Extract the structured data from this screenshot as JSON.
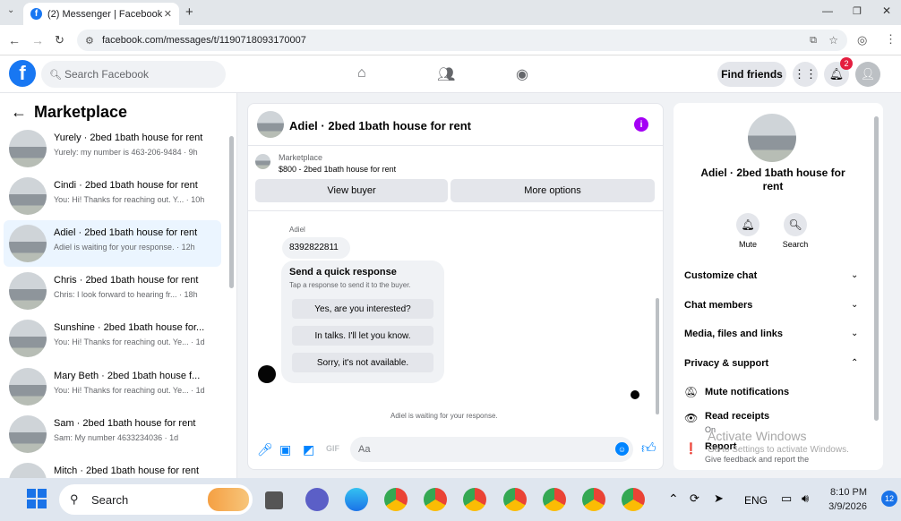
{
  "browser": {
    "tab_title": "(2) Messenger | Facebook",
    "url": "facebook.com/messages/t/1190718093170007"
  },
  "fb_header": {
    "logo": "f",
    "search_placeholder": "Search Facebook",
    "find_friends": "Find friends",
    "notification_count": "2"
  },
  "left": {
    "title": "Marketplace",
    "conversations": [
      {
        "name": "Yurely · 2bed 1bath house for rent",
        "preview": "Yurely: my number is 463-206-9484 · 9h"
      },
      {
        "name": "Cindi · 2bed 1bath house for rent",
        "preview": "You: Hi! Thanks for reaching out. Y... · 10h"
      },
      {
        "name": "Adiel · 2bed 1bath house for rent",
        "preview": "Adiel is waiting for your response. · 12h"
      },
      {
        "name": "Chris · 2bed 1bath house for rent",
        "preview": "Chris: I look forward to hearing fr... · 18h"
      },
      {
        "name": "Sunshine · 2bed 1bath house for...",
        "preview": "You: Hi! Thanks for reaching out. Ye... · 1d"
      },
      {
        "name": "Mary Beth · 2bed 1bath house f...",
        "preview": "You: Hi! Thanks for reaching out. Ye... · 1d"
      },
      {
        "name": "Sam · 2bed 1bath house for rent",
        "preview": "Sam: My number 4633234036 · 1d"
      },
      {
        "name": "Mitch · 2bed 1bath house for rent",
        "preview": ""
      }
    ]
  },
  "chat": {
    "title": "Adiel · 2bed 1bath house for rent",
    "listing_label": "Marketplace",
    "listing_price": "$800 - 2bed 1bath house for rent",
    "view_buyer": "View buyer",
    "more_options": "More options",
    "sender": "Adiel",
    "message": "8392822811",
    "quick_title": "Send a quick response",
    "quick_sub": "Tap a response to send it to the buyer.",
    "quick_1": "Yes, are you interested?",
    "quick_2": "In talks. I'll let you know.",
    "quick_3": "Sorry, it's not available.",
    "status": "Adiel is waiting for your response.",
    "composer_placeholder": "Aa"
  },
  "right": {
    "title": "Adiel · 2bed 1bath house for rent",
    "mute": "Mute",
    "search": "Search",
    "customize": "Customize chat",
    "members": "Chat members",
    "media": "Media, files and links",
    "privacy": "Privacy & support",
    "mute_notif": "Mute notifications",
    "read_receipts": "Read receipts",
    "read_on": "On",
    "report": "Report",
    "report_sub": "Give feedback and report the",
    "watermark_1": "Activate Windows",
    "watermark_2": "Go to Settings to activate Windows."
  },
  "taskbar": {
    "search": "Search",
    "lang": "ENG",
    "time": "8:10 PM",
    "date": "3/9/2026",
    "notif_count": "12"
  }
}
